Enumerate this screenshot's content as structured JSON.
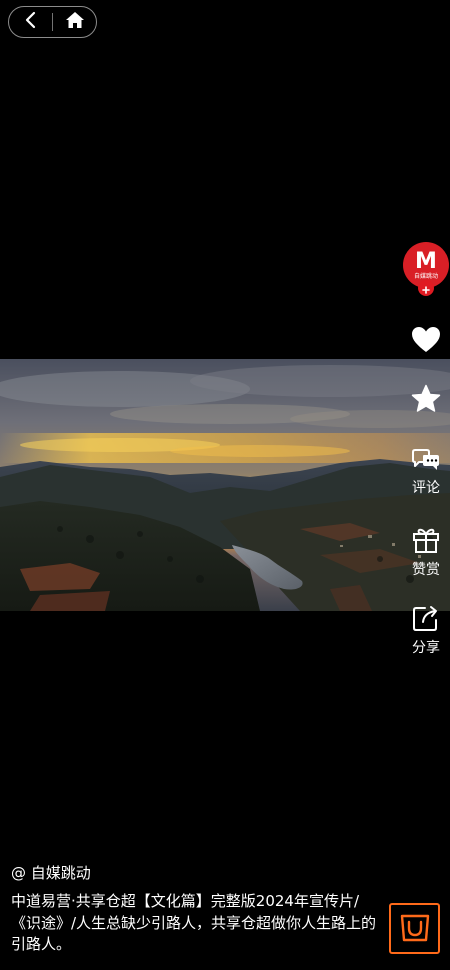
{
  "nav": {
    "back_icon": "chevron-left-icon",
    "home_icon": "home-icon"
  },
  "video": {
    "scene": "aerial-mountain-sunset"
  },
  "author": {
    "avatar_letter": "M",
    "avatar_caption": "自媒跳动",
    "follow_icon": "plus-icon"
  },
  "actions": {
    "like_icon": "heart-icon",
    "favorite_icon": "star-icon",
    "comment_icon": "comment-icon",
    "comment_label": "评论",
    "reward_icon": "gift-icon",
    "reward_label": "赞赏",
    "share_icon": "share-icon",
    "share_label": "分享"
  },
  "info": {
    "author_name": "@ 自媒跳动",
    "description": "中道易营·共享仓超【文化篇】完整版2024年宣传片/《识途》/人生总缺少引路人，共享仓超做你人生路上的引路人。"
  },
  "shop": {
    "icon": "shopping-bag-icon"
  },
  "colors": {
    "background": "#000000",
    "avatar_red": "#d91f26",
    "shop_orange": "#ff6a1a"
  }
}
